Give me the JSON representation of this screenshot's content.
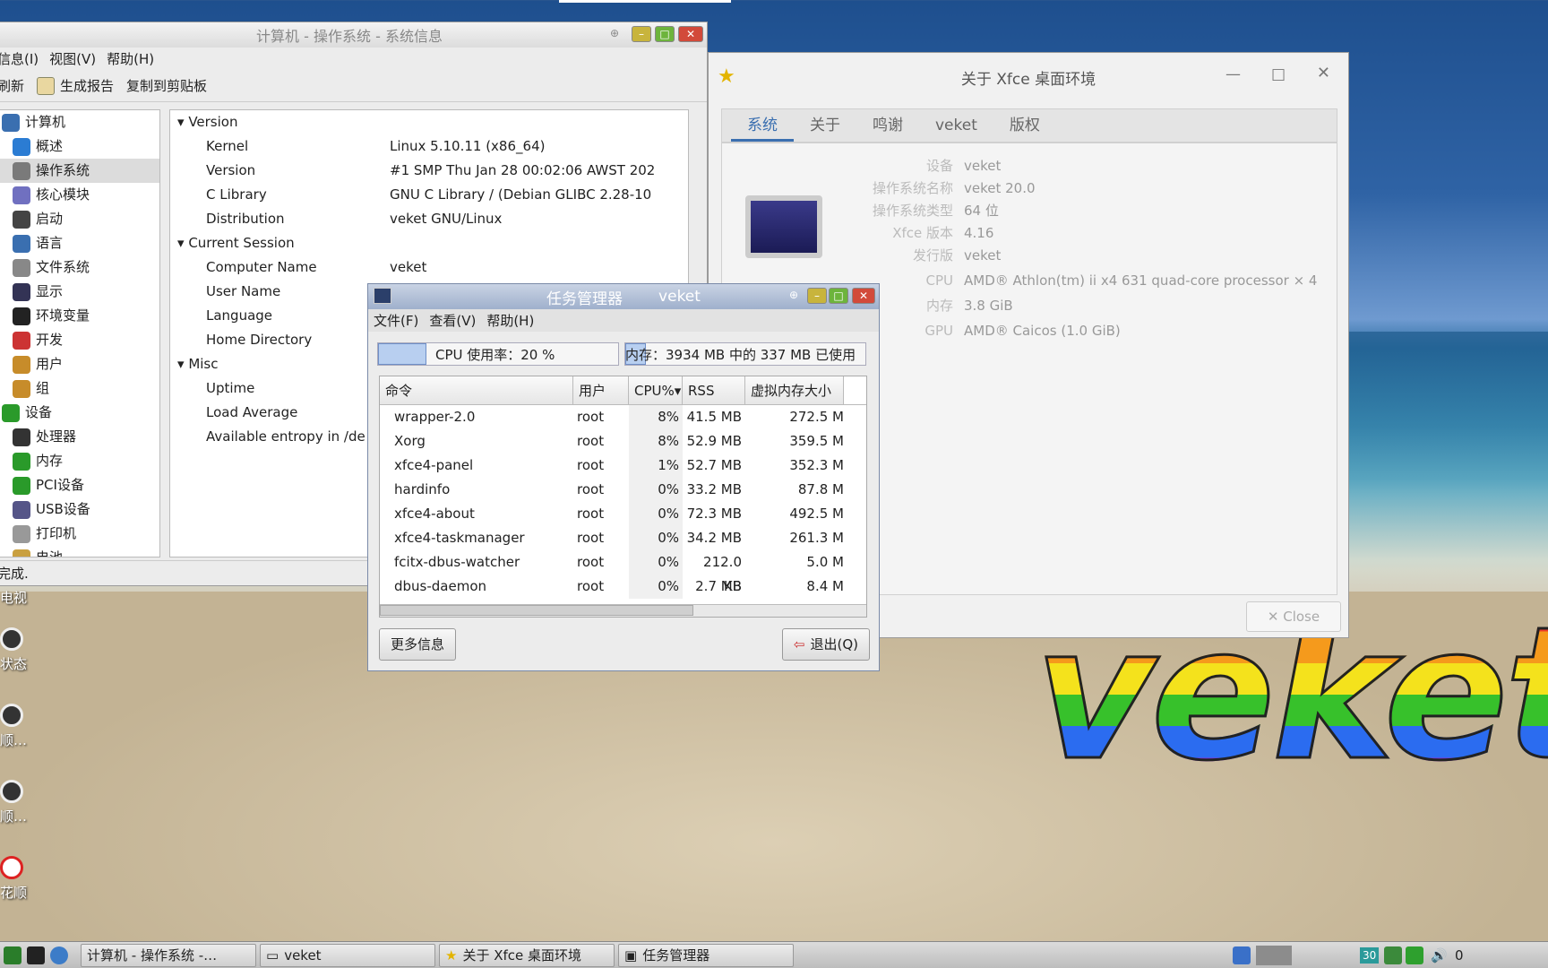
{
  "hardinfo": {
    "title": "计算机 - 操作系统 - 系统信息",
    "menu": [
      "信息(I)",
      "视图(V)",
      "帮助(H)"
    ],
    "toolbar": {
      "refresh": "刷新",
      "report": "生成报告",
      "copy": "复制到剪贴板"
    },
    "side": [
      {
        "label": "计算机",
        "sub": false
      },
      {
        "label": "概述",
        "sub": true
      },
      {
        "label": "操作系统",
        "sub": true,
        "selected": true
      },
      {
        "label": "核心模块",
        "sub": true
      },
      {
        "label": "启动",
        "sub": true
      },
      {
        "label": "语言",
        "sub": true
      },
      {
        "label": "文件系统",
        "sub": true
      },
      {
        "label": "显示",
        "sub": true
      },
      {
        "label": "环境变量",
        "sub": true
      },
      {
        "label": "开发",
        "sub": true
      },
      {
        "label": "用户",
        "sub": true
      },
      {
        "label": "组",
        "sub": true
      },
      {
        "label": "设备",
        "sub": false
      },
      {
        "label": "处理器",
        "sub": true
      },
      {
        "label": "内存",
        "sub": true
      },
      {
        "label": "PCI设备",
        "sub": true
      },
      {
        "label": "USB设备",
        "sub": true
      },
      {
        "label": "打印机",
        "sub": true
      },
      {
        "label": "电池",
        "sub": true
      }
    ],
    "rows": [
      {
        "k": "Version",
        "v": "",
        "group": true
      },
      {
        "k": "Kernel",
        "v": "Linux 5.10.11 (x86_64)"
      },
      {
        "k": "Version",
        "v": "#1 SMP Thu Jan 28 00:02:06 AWST 202"
      },
      {
        "k": "C Library",
        "v": "GNU C Library / (Debian GLIBC 2.28-10"
      },
      {
        "k": "Distribution",
        "v": "veket GNU/Linux"
      },
      {
        "k": "Current Session",
        "v": "",
        "group": true
      },
      {
        "k": "Computer Name",
        "v": "veket"
      },
      {
        "k": "User Name",
        "v": ""
      },
      {
        "k": "Language",
        "v": ""
      },
      {
        "k": "Home Directory",
        "v": ""
      },
      {
        "k": "Misc",
        "v": "",
        "group": true
      },
      {
        "k": "Uptime",
        "v": ""
      },
      {
        "k": "Load Average",
        "v": ""
      },
      {
        "k": "Available entropy in /de",
        "v": ""
      }
    ],
    "status": "完成."
  },
  "about": {
    "title": "关于 Xfce 桌面环境",
    "tabs": [
      "系统",
      "关于",
      "鸣谢",
      "veket",
      "版权"
    ],
    "rows": [
      {
        "l": "设备",
        "r": "veket"
      },
      {
        "l": "操作系统名称",
        "r": "veket 20.0"
      },
      {
        "l": "操作系统类型",
        "r": "64 位"
      },
      {
        "l": "Xfce 版本",
        "r": "4.16"
      },
      {
        "l": "发行版",
        "r": "veket"
      },
      {
        "l": "CPU",
        "r": "AMD® Athlon(tm) ii x4 631 quad-core processor × 4"
      },
      {
        "l": "内存",
        "r": "3.8 GiB"
      },
      {
        "l": "GPU",
        "r": "AMD® Caicos (1.0 GiB)"
      }
    ],
    "close": "Close"
  },
  "taskmgr": {
    "title": "任务管理器",
    "host": "veket",
    "menu": [
      "文件(F)",
      "查看(V)",
      "帮助(H)"
    ],
    "cpu_label": "CPU 使用率：20 %",
    "cpu_fraction": 0.2,
    "mem_label": "内存：3934 MB 中的 337 MB 已使用",
    "mem_fraction": 0.086,
    "columns": [
      "命令",
      "用户",
      "CPU%",
      "RSS",
      "虚拟内存大小"
    ],
    "procs": [
      [
        "wrapper-2.0",
        "root",
        "8%",
        "41.5 MB",
        "272.5 M"
      ],
      [
        "Xorg",
        "root",
        "8%",
        "52.9 MB",
        "359.5 M"
      ],
      [
        "xfce4-panel",
        "root",
        "1%",
        "52.7 MB",
        "352.3 M"
      ],
      [
        "hardinfo",
        "root",
        "0%",
        "33.2 MB",
        "87.8 M"
      ],
      [
        "xfce4-about",
        "root",
        "0%",
        "72.3 MB",
        "492.5 M"
      ],
      [
        "xfce4-taskmanager",
        "root",
        "0%",
        "34.2 MB",
        "261.3 M"
      ],
      [
        "fcitx-dbus-watcher",
        "root",
        "0%",
        "212.0 KB",
        "5.0 M"
      ],
      [
        "dbus-daemon",
        "root",
        "0%",
        "2.7 MB",
        "8.4 M"
      ]
    ],
    "more": "更多信息",
    "quit": "退出(Q)"
  },
  "desktop": {
    "icons": [
      "电视",
      "状态",
      "顺…",
      "顺…",
      "花顺"
    ],
    "brand": "veket"
  },
  "taskbar": {
    "items": [
      "计算机 - 操作系统 -…",
      "veket",
      "关于 Xfce 桌面环境",
      "任务管理器"
    ],
    "tray_num": "30",
    "clock": "0"
  }
}
